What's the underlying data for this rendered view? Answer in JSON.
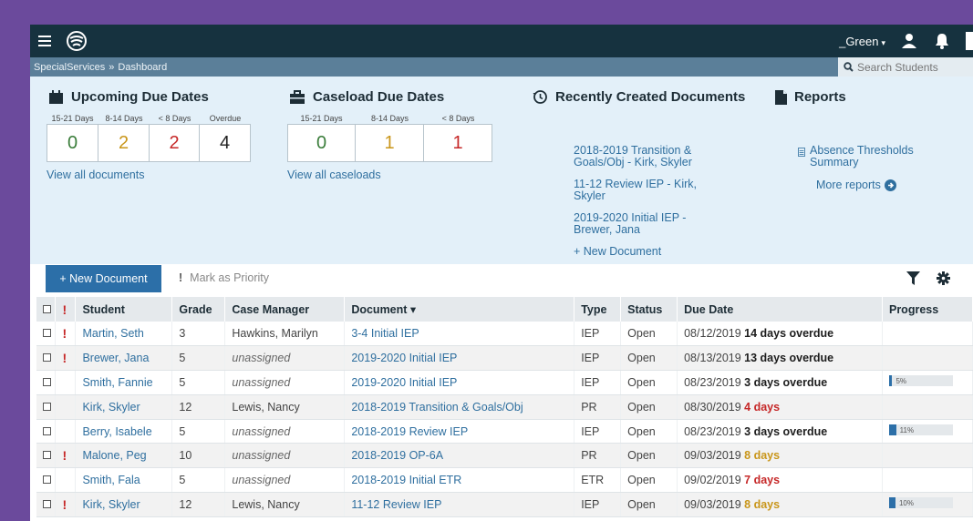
{
  "nav": {
    "user": "_Green",
    "user_caret": "▾"
  },
  "breadcrumb": {
    "root": "SpecialServices",
    "sep": "»",
    "current": "Dashboard"
  },
  "search": {
    "placeholder": "Search Students"
  },
  "upcoming": {
    "title": "Upcoming Due Dates",
    "labels": [
      "15-21 Days",
      "8-14 Days",
      "< 8 Days",
      "Overdue"
    ],
    "values": [
      "0",
      "2",
      "2",
      "4"
    ],
    "colors": [
      "#3a7d3a",
      "#c9961a",
      "#c62828",
      "#222222"
    ],
    "link": "View all documents"
  },
  "caseload": {
    "title": "Caseload Due Dates",
    "labels": [
      "15-21 Days",
      "8-14 Days",
      "< 8 Days"
    ],
    "values": [
      "0",
      "1",
      "1"
    ],
    "colors": [
      "#3a7d3a",
      "#c9961a",
      "#c62828"
    ],
    "link": "View all caseloads"
  },
  "recent": {
    "title": "Recently Created Documents",
    "items": [
      "2018-2019 Transition & Goals/Obj - Kirk, Skyler",
      "11-12 Review IEP - Kirk, Skyler",
      "2019-2020 Initial IEP - Brewer, Jana"
    ],
    "new_doc": "+ New Document"
  },
  "reports": {
    "title": "Reports",
    "items": [
      "Absence Thresholds Summary"
    ],
    "more": "More reports"
  },
  "toolbar": {
    "new_doc": "+ New Document",
    "mark_priority": "Mark as Priority"
  },
  "table": {
    "headers": [
      "Student",
      "Grade",
      "Case Manager",
      "Document",
      "Type",
      "Status",
      "Due Date",
      "Progress"
    ],
    "sort_caret": "▾",
    "rows": [
      {
        "flag": true,
        "student": "Martin, Seth",
        "grade": "3",
        "manager": "Hawkins, Marilyn",
        "assigned": true,
        "document": "3-4 Initial IEP",
        "type": "IEP",
        "status": "Open",
        "date": "08/12/2019",
        "due": "14 days overdue",
        "due_style": "over",
        "progress": null
      },
      {
        "flag": true,
        "student": "Brewer, Jana",
        "grade": "5",
        "manager": "unassigned",
        "assigned": false,
        "document": "2019-2020 Initial IEP",
        "type": "IEP",
        "status": "Open",
        "date": "08/13/2019",
        "due": "13 days overdue",
        "due_style": "over",
        "progress": null
      },
      {
        "flag": false,
        "student": "Smith, Fannie",
        "grade": "5",
        "manager": "unassigned",
        "assigned": false,
        "document": "2019-2020 Initial IEP",
        "type": "IEP",
        "status": "Open",
        "date": "08/23/2019",
        "due": "3 days overdue",
        "due_style": "over",
        "progress": "5%"
      },
      {
        "flag": false,
        "student": "Kirk, Skyler",
        "grade": "12",
        "manager": "Lewis, Nancy",
        "assigned": true,
        "document": "2018-2019 Transition & Goals/Obj",
        "type": "PR",
        "status": "Open",
        "date": "08/30/2019",
        "due": "4 days",
        "due_style": "red",
        "progress": null
      },
      {
        "flag": false,
        "student": "Berry, Isabele",
        "grade": "5",
        "manager": "unassigned",
        "assigned": false,
        "document": "2018-2019 Review IEP",
        "type": "IEP",
        "status": "Open",
        "date": "08/23/2019",
        "due": "3 days overdue",
        "due_style": "over",
        "progress": "11%"
      },
      {
        "flag": true,
        "student": "Malone, Peg",
        "grade": "10",
        "manager": "unassigned",
        "assigned": false,
        "document": "2018-2019 OP-6A",
        "type": "PR",
        "status": "Open",
        "date": "09/03/2019",
        "due": "8 days",
        "due_style": "amber",
        "progress": null
      },
      {
        "flag": false,
        "student": "Smith, Fala",
        "grade": "5",
        "manager": "unassigned",
        "assigned": false,
        "document": "2018-2019 Initial ETR",
        "type": "ETR",
        "status": "Open",
        "date": "09/02/2019",
        "due": "7 days",
        "due_style": "red",
        "progress": null
      },
      {
        "flag": true,
        "student": "Kirk, Skyler",
        "grade": "12",
        "manager": "Lewis, Nancy",
        "assigned": true,
        "document": "11-12 Review IEP",
        "type": "IEP",
        "status": "Open",
        "date": "09/03/2019",
        "due": "8 days",
        "due_style": "amber",
        "progress": "10%"
      }
    ]
  }
}
